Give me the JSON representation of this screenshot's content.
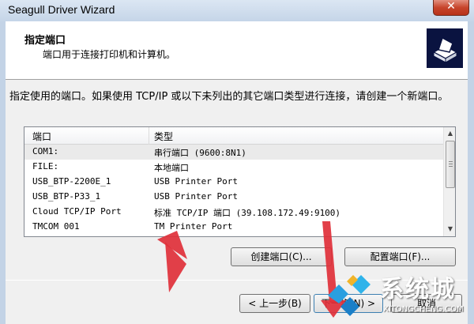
{
  "window": {
    "title": "Seagull Driver Wizard",
    "close_label": "✕"
  },
  "header": {
    "title": "指定端口",
    "subtitle": "端口用于连接打印机和计算机。",
    "icon": "printer-icon"
  },
  "description": "指定使用的端口。如果使用 TCP/IP 或以下未列出的其它端口类型进行连接，请创建一个新端口。",
  "port_list": {
    "columns": [
      "端口",
      "类型"
    ],
    "rows": [
      {
        "name": "COM1:",
        "type": "串行端口 (9600:8N1)",
        "selected": true
      },
      {
        "name": "FILE:",
        "type": "本地端口"
      },
      {
        "name": "USB_BTP-2200E_1",
        "type": "USB Printer Port"
      },
      {
        "name": "USB_BTP-P33_1",
        "type": "USB Printer Port"
      },
      {
        "name": "Cloud TCP/IP Port",
        "type": "标准 TCP/IP 端口 (39.108.172.49:9100)"
      },
      {
        "name": "TMCOM 001",
        "type": "TM Printer Port"
      }
    ]
  },
  "buttons": {
    "create_port": "创建端口(C)...",
    "configure_port": "配置端口(F)...",
    "back": "< 上一步(B)",
    "next": "下一步(N) >",
    "cancel": "取消"
  },
  "watermark": {
    "text": "系统城",
    "url": "XITONGCHENG.COM"
  },
  "colors": {
    "annotation_arrow": "#e0303a",
    "close_button": "#c7452c"
  }
}
